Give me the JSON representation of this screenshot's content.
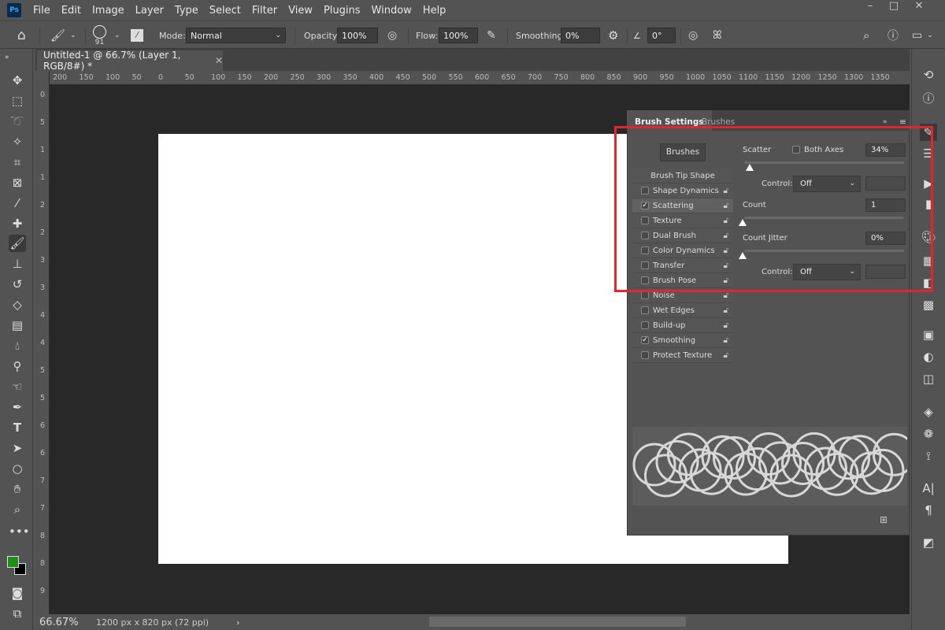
{
  "menubar": {
    "logo": "Ps",
    "items": [
      "File",
      "Edit",
      "Image",
      "Layer",
      "Type",
      "Select",
      "Filter",
      "View",
      "Plugins",
      "Window",
      "Help"
    ]
  },
  "options": {
    "brush_size": "91",
    "mode_label": "Mode:",
    "mode_value": "Normal",
    "opacity_label": "Opacity:",
    "opacity_value": "100%",
    "flow_label": "Flow:",
    "flow_value": "100%",
    "smoothing_label": "Smoothing:",
    "smoothing_value": "0%",
    "angle_value": "0°"
  },
  "document": {
    "tab_title": "Untitled-1 @ 66.7% (Layer 1, RGB/8#) *",
    "ruler_top": [
      "200",
      "150",
      "100",
      "50",
      "0",
      "50",
      "100",
      "150",
      "200",
      "250",
      "300",
      "350",
      "400",
      "450",
      "500",
      "550",
      "600",
      "650",
      "700",
      "750",
      "800",
      "850",
      "900",
      "950",
      "1000",
      "1050",
      "1100",
      "1150",
      "1200",
      "1250",
      "1300",
      "1350"
    ],
    "ruler_left": [
      "0",
      "5",
      "1",
      "1",
      "2",
      "2",
      "3",
      "3",
      "4",
      "4",
      "5",
      "5",
      "6",
      "6",
      "7",
      "7",
      "8",
      "8",
      "9"
    ]
  },
  "status": {
    "zoom": "66.67%",
    "doc_info": "1200 px x 820 px (72 ppi)"
  },
  "colors": {
    "foreground": "#1e8f1e",
    "background": "#000000",
    "highlight": "#e3262b"
  },
  "panel": {
    "tabs": [
      "Brush Settings",
      "Brushes"
    ],
    "brushes_button": "Brushes",
    "tip_shape": "Brush Tip Shape",
    "items": [
      {
        "label": "Shape Dynamics",
        "checked": false
      },
      {
        "label": "Scattering",
        "checked": true
      },
      {
        "label": "Texture",
        "checked": false
      },
      {
        "label": "Dual Brush",
        "checked": false
      },
      {
        "label": "Color Dynamics",
        "checked": false
      },
      {
        "label": "Transfer",
        "checked": false
      },
      {
        "label": "Brush Pose",
        "checked": false
      },
      {
        "label": "Noise",
        "checked": false
      },
      {
        "label": "Wet Edges",
        "checked": false
      },
      {
        "label": "Build-up",
        "checked": false
      },
      {
        "label": "Smoothing",
        "checked": true
      },
      {
        "label": "Protect Texture",
        "checked": false
      }
    ],
    "scatter_label": "Scatter",
    "both_axes_label": "Both Axes",
    "both_axes_checked": false,
    "scatter_value": "34%",
    "scatter_level": 34,
    "control_label": "Control:",
    "control1_value": "Off",
    "count_label": "Count",
    "count_value": "1",
    "count_jitter_label": "Count Jitter",
    "count_jitter_value": "0%",
    "count_jitter_level": 0,
    "control2_value": "Off"
  }
}
